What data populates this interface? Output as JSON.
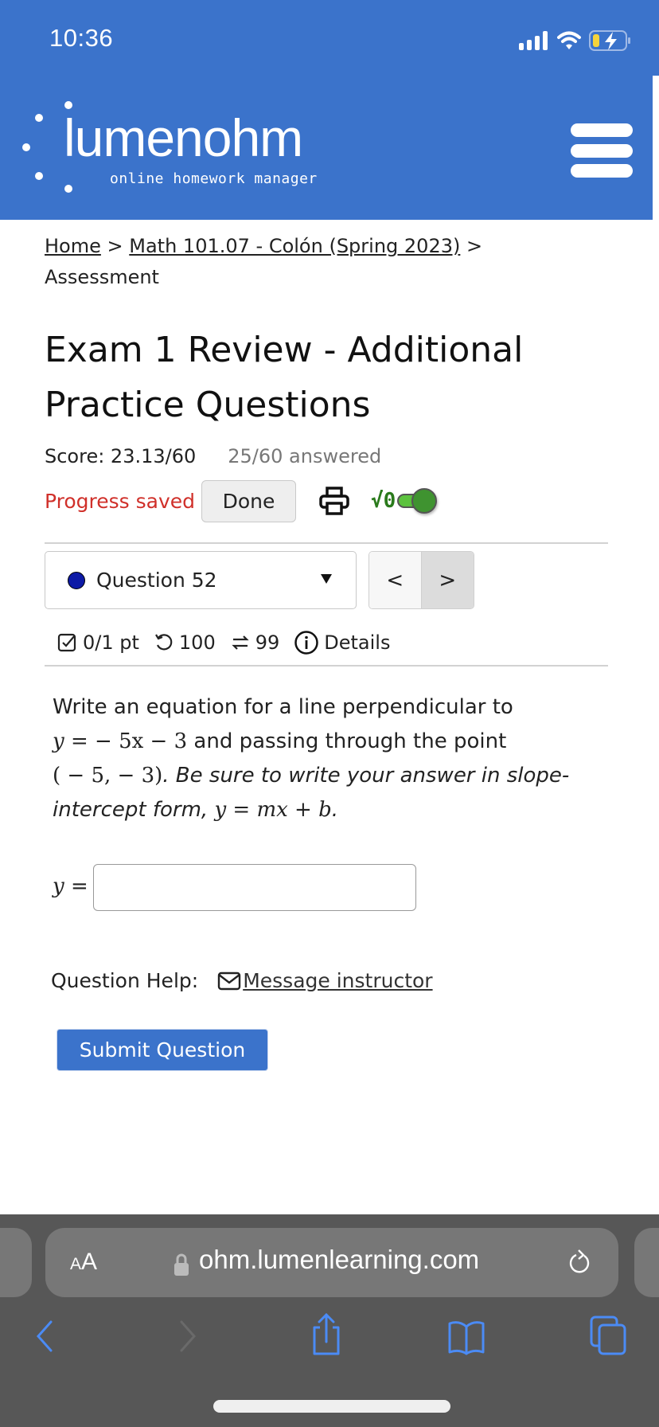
{
  "status_bar": {
    "time": "10:36",
    "icons": [
      "cellular-signal-icon",
      "wifi-icon",
      "battery-charging-icon"
    ],
    "battery_fill_color": "#F5D33B"
  },
  "header": {
    "logo_text": "lumenohm",
    "logo_subtitle": "online homework manager",
    "menu_icon": "hamburger-menu-icon",
    "brand_color": "#3B73CB"
  },
  "breadcrumb": {
    "items": [
      {
        "label": "Home",
        "link": true
      },
      {
        "label": "Math 101.07 - Colón (Spring 2023)",
        "link": true
      },
      {
        "label": "Assessment",
        "link": false
      }
    ],
    "separator": ">"
  },
  "assessment": {
    "title": "Exam 1 Review - Additional Practice Questions",
    "score": "Score: 23.13/60",
    "answered": "25/60 answered",
    "progress_status": "Progress saved",
    "done_label": "Done",
    "print_icon": "printer-icon",
    "math_toggle_label": "√0",
    "math_toggle_on": true
  },
  "question_nav": {
    "selected": "Question 52",
    "status_dot_color": "#0D1AA6",
    "prev_label": "<",
    "next_label": ">"
  },
  "question_info": {
    "points": "0/1 pt",
    "attempts": "100",
    "retries": "99",
    "details_label": "Details"
  },
  "question": {
    "intro": "Write an equation for a line perpendicular to",
    "equation": {
      "lhs": "y",
      "eq": " = ",
      "rhs": "− 5x − 3"
    },
    "middle": " and passing through the point",
    "point": "( − 5,  − 3)",
    "instruction": ". Be sure to write your answer in slope-intercept form, ",
    "form": "y = mx + b",
    "end": "."
  },
  "answer": {
    "label_var": "y",
    "label_eq": " =",
    "value": "",
    "placeholder": ""
  },
  "help": {
    "label": "Question Help:",
    "message_link": "Message instructor"
  },
  "submit_label": "Submit Question",
  "browser": {
    "aa_small": "A",
    "aa_large": "A",
    "url": "ohm.lumenlearning.com",
    "toolbar": [
      "back-icon",
      "forward-icon",
      "share-icon",
      "bookmarks-icon",
      "tabs-icon"
    ],
    "accent_color": "#4B8BF5"
  }
}
